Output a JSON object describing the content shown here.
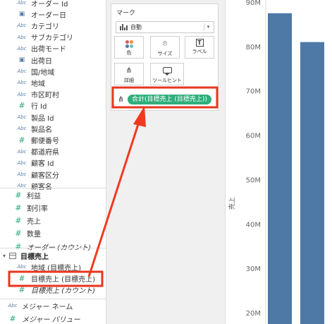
{
  "data_pane": {
    "dimensions": [
      {
        "icon": "Abc",
        "type": "text",
        "label": "オーダー Id"
      },
      {
        "icon": "calendar",
        "type": "date",
        "label": "オーダー日"
      },
      {
        "icon": "Abc",
        "type": "text",
        "label": "カテゴリ"
      },
      {
        "icon": "Abc",
        "type": "text",
        "label": "サブカテゴリ"
      },
      {
        "icon": "Abc",
        "type": "text",
        "label": "出荷モード"
      },
      {
        "icon": "calendar",
        "type": "date",
        "label": "出荷日"
      },
      {
        "icon": "Abc",
        "type": "text",
        "label": "国/地域"
      },
      {
        "icon": "Abc",
        "type": "text",
        "label": "地域"
      },
      {
        "icon": "Abc",
        "type": "text",
        "label": "市区町村"
      },
      {
        "icon": "#",
        "type": "number",
        "label": "行 Id"
      },
      {
        "icon": "Abc",
        "type": "text",
        "label": "製品 Id"
      },
      {
        "icon": "Abc",
        "type": "text",
        "label": "製品名"
      },
      {
        "icon": "#",
        "type": "number",
        "label": "郵便番号"
      },
      {
        "icon": "Abc",
        "type": "text",
        "label": "都道府県"
      },
      {
        "icon": "Abc",
        "type": "text",
        "label": "顧客 Id"
      },
      {
        "icon": "Abc",
        "type": "text",
        "label": "顧客区分"
      },
      {
        "icon": "Abc",
        "type": "text",
        "label": "顧客名"
      }
    ],
    "measures": [
      {
        "icon": "#",
        "label": "利益"
      },
      {
        "icon": "#",
        "label": "割引率"
      },
      {
        "icon": "#",
        "label": "売上"
      },
      {
        "icon": "#",
        "label": "数量"
      },
      {
        "icon": "#",
        "label": "オーダー (カウント)"
      }
    ],
    "folder": {
      "label": "目標売上"
    },
    "folder_fields": [
      {
        "icon": "Abc",
        "label": "地域 (目標売上)"
      },
      {
        "icon": "#",
        "label": "目標売上 (目標売上)"
      },
      {
        "icon": "#",
        "label": "目標売上 (カウント)"
      }
    ],
    "bottom_fields": [
      {
        "icon": "Abc",
        "label": "メジャー ネーム"
      },
      {
        "icon": "#",
        "label": "メジャー バリュー"
      }
    ]
  },
  "marks": {
    "title": "マーク",
    "mark_type": "自動",
    "buttons": [
      {
        "label": "色",
        "icon": "color-dots-icon"
      },
      {
        "label": "サイズ",
        "icon": "size-icon"
      },
      {
        "label": "ラベル",
        "icon": "text-label-icon"
      },
      {
        "label": "詳細",
        "icon": "detail-icon"
      },
      {
        "label": "ツールヒント",
        "icon": "tooltip-icon"
      }
    ],
    "detail_pill": "合計(目標売上 (目標売上))"
  },
  "annotation": {
    "box_color": "#e8361f",
    "arrow_color": "#f03a1f"
  },
  "chart_data": {
    "type": "bar",
    "ylabel": "売上",
    "ylim": [
      17000000,
      90000000
    ],
    "y_ticks": [
      20000000,
      30000000,
      40000000,
      50000000,
      60000000,
      70000000,
      80000000,
      90000000
    ],
    "y_tick_labels": [
      "20M",
      "30M",
      "40M",
      "50M",
      "60M",
      "70M",
      "80M",
      "90M"
    ],
    "series": [
      {
        "values": [
          87500000,
          81000000
        ]
      }
    ],
    "bar_color": "#4e79a7"
  }
}
